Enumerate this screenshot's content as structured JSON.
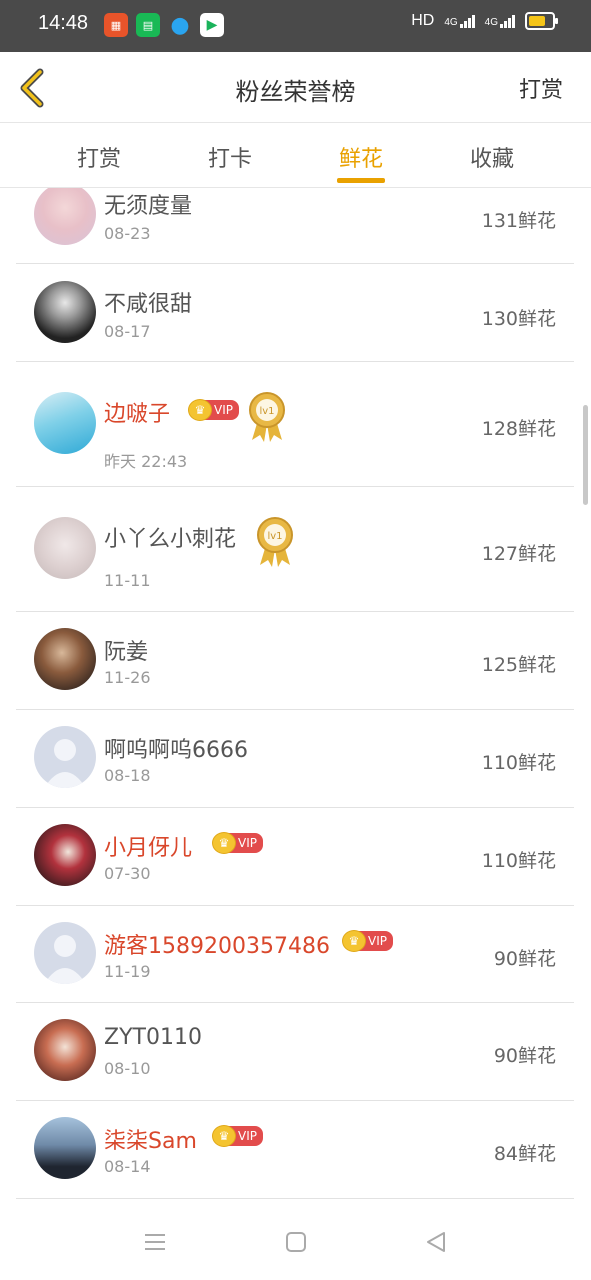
{
  "status": {
    "time": "14:48",
    "hd": "HD",
    "net1": "4G",
    "net2": "4G"
  },
  "header": {
    "title": "粉丝荣誉榜",
    "right_action": "打赏"
  },
  "tabs": [
    {
      "label": "打赏",
      "active": false
    },
    {
      "label": "打卡",
      "active": false
    },
    {
      "label": "鲜花",
      "active": true
    },
    {
      "label": "收藏",
      "active": false
    }
  ],
  "rows": [
    {
      "name": "无须度量",
      "date": "08-23",
      "count": "131鲜花",
      "vip": false,
      "medal": false
    },
    {
      "name": "不咸很甜",
      "date": "08-17",
      "count": "130鲜花",
      "vip": false,
      "medal": false
    },
    {
      "name": "边啵子",
      "date": "昨天 22:43",
      "count": "128鲜花",
      "vip": true,
      "medal": true
    },
    {
      "name": "小丫么小刺花",
      "date": "11-11",
      "count": "127鲜花",
      "vip": false,
      "medal": true
    },
    {
      "name": "阮姜",
      "date": "11-26",
      "count": "125鲜花",
      "vip": false,
      "medal": false
    },
    {
      "name": "啊呜啊呜6666",
      "date": "08-18",
      "count": "110鲜花",
      "vip": false,
      "medal": false
    },
    {
      "name": "小月伢儿",
      "date": "07-30",
      "count": "110鲜花",
      "vip": true,
      "medal": false
    },
    {
      "name": "游客1589200357486",
      "date": "11-19",
      "count": "90鲜花",
      "vip": true,
      "medal": false
    },
    {
      "name": "ZYT0110",
      "date": "08-10",
      "count": "90鲜花",
      "vip": false,
      "medal": false
    },
    {
      "name": "柒柒Sam",
      "date": "08-14",
      "count": "84鲜花",
      "vip": true,
      "medal": false
    }
  ],
  "badges": {
    "vip": "VIP",
    "medal": "lv1"
  },
  "colors": {
    "accent": "#e9a100",
    "vip_name": "#d9472b",
    "vip_tag": "#e24c4c"
  }
}
